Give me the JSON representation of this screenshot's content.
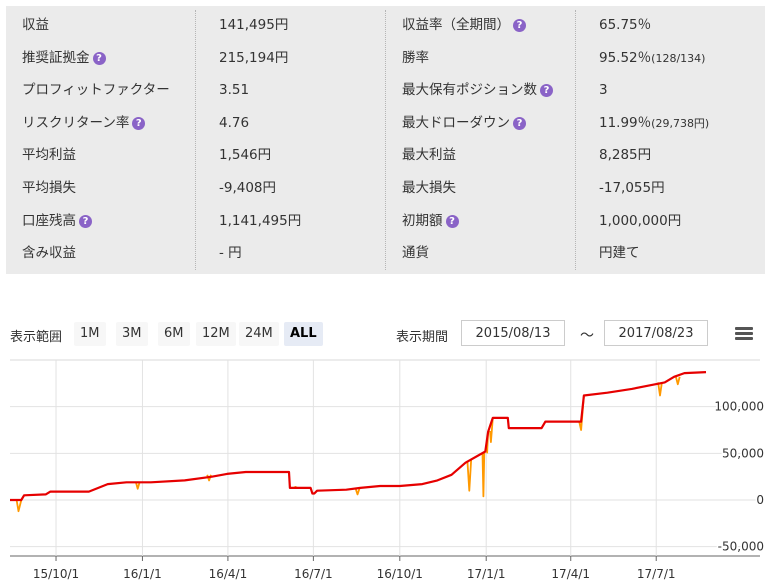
{
  "stats": {
    "rows": [
      {
        "l1": "収益",
        "h1": false,
        "v1": "141,495円",
        "l2": "収益率（全期間）",
        "h2": true,
        "v2": "65.75％",
        "v2sub": ""
      },
      {
        "l1": "推奨証拠金",
        "h1": true,
        "v1": "215,194円",
        "l2": "勝率",
        "h2": false,
        "v2": "95.52％",
        "v2sub": "(128/134)"
      },
      {
        "l1": "プロフィットファクター",
        "h1": false,
        "v1": "3.51",
        "l2": "最大保有ポジション数",
        "h2": true,
        "v2": "3",
        "v2sub": ""
      },
      {
        "l1": "リスクリターン率",
        "h1": true,
        "v1": "4.76",
        "l2": "最大ドローダウン",
        "h2": true,
        "v2": "11.99％",
        "v2sub": "(29,738円)"
      },
      {
        "l1": "平均利益",
        "h1": false,
        "v1": "1,546円",
        "l2": "最大利益",
        "h2": false,
        "v2": "8,285円",
        "v2sub": ""
      },
      {
        "l1": "平均損失",
        "h1": false,
        "v1": "-9,408円",
        "l2": "最大損失",
        "h2": false,
        "v2": "-17,055円",
        "v2sub": ""
      },
      {
        "l1": "口座残高",
        "h1": true,
        "v1": "1,141,495円",
        "l2": "初期額",
        "h2": true,
        "v2": "1,000,000円",
        "v2sub": ""
      },
      {
        "l1": "含み収益",
        "h1": false,
        "v1": "- 円",
        "l2": "通貨",
        "h2": false,
        "v2": "円建て",
        "v2sub": ""
      }
    ],
    "help_glyph": "?"
  },
  "toolbar": {
    "range_label": "表示範囲",
    "range_buttons": [
      "1M",
      "3M",
      "6M",
      "12M",
      "24M",
      "ALL"
    ],
    "active_range": "ALL",
    "period_label": "表示期間",
    "date_from": "2015/08/13",
    "tilde": "～",
    "date_to": "2017/08/23"
  },
  "chart_data": {
    "type": "line",
    "x_tick_labels": [
      "15/10/1",
      "16/1/1",
      "16/4/1",
      "16/7/1",
      "16/10/1",
      "17/1/1",
      "17/4/1",
      "17/7/1"
    ],
    "x_tick_dates": [
      "2015-10-01",
      "2016-01-01",
      "2016-04-01",
      "2016-07-01",
      "2016-10-01",
      "2017-01-01",
      "2017-04-01",
      "2017-07-01"
    ],
    "x_range": [
      "2015-08-13",
      "2017-08-23"
    ],
    "y_ticks": [
      100000,
      50000,
      0,
      -50000
    ],
    "y_tick_labels": [
      "100,000",
      "50,000",
      "0",
      "-50,000"
    ],
    "ylim": [
      -60000,
      150000
    ],
    "grid": true,
    "series": [
      {
        "color": "#e60000",
        "points": [
          [
            "2015-08-13",
            0
          ],
          [
            "2015-08-25",
            0
          ],
          [
            "2015-08-28",
            5000
          ],
          [
            "2015-09-20",
            6000
          ],
          [
            "2015-09-25",
            9000
          ],
          [
            "2015-11-05",
            9000
          ],
          [
            "2015-11-25",
            17000
          ],
          [
            "2015-12-15",
            19000
          ],
          [
            "2016-01-10",
            19000
          ],
          [
            "2016-02-15",
            21000
          ],
          [
            "2016-03-15",
            25000
          ],
          [
            "2016-03-31",
            28000
          ],
          [
            "2016-04-20",
            30000
          ],
          [
            "2016-06-05",
            30000
          ],
          [
            "2016-06-06",
            13000
          ],
          [
            "2016-06-28",
            13000
          ],
          [
            "2016-06-30",
            7000
          ],
          [
            "2016-07-02",
            7000
          ],
          [
            "2016-07-05",
            10000
          ],
          [
            "2016-08-05",
            11000
          ],
          [
            "2016-08-20",
            13000
          ],
          [
            "2016-09-10",
            15000
          ],
          [
            "2016-10-01",
            15000
          ],
          [
            "2016-10-25",
            17000
          ],
          [
            "2016-11-10",
            21000
          ],
          [
            "2016-11-25",
            27000
          ],
          [
            "2016-12-10",
            40000
          ],
          [
            "2016-12-31",
            52000
          ],
          [
            "2017-01-03",
            73000
          ],
          [
            "2017-01-08",
            88000
          ],
          [
            "2017-01-24",
            88000
          ],
          [
            "2017-01-25",
            77000
          ],
          [
            "2017-03-01",
            77000
          ],
          [
            "2017-03-05",
            84000
          ],
          [
            "2017-04-12",
            84000
          ],
          [
            "2017-04-15",
            112000
          ],
          [
            "2017-05-10",
            115000
          ],
          [
            "2017-06-05",
            119000
          ],
          [
            "2017-06-25",
            123000
          ],
          [
            "2017-07-10",
            126000
          ],
          [
            "2017-07-20",
            132000
          ],
          [
            "2017-07-31",
            136000
          ],
          [
            "2017-08-23",
            137000
          ]
        ]
      },
      {
        "color": "#ff9900",
        "points": [
          [
            "2015-08-20",
            0
          ],
          [
            "2015-08-22",
            -12000
          ],
          [
            "2015-08-25",
            0
          ],
          [
            "2015-12-25",
            19000
          ],
          [
            "2015-12-27",
            12000
          ],
          [
            "2015-12-29",
            19000
          ],
          [
            "2016-03-10",
            27000
          ],
          [
            "2016-03-12",
            21000
          ],
          [
            "2016-03-14",
            27000
          ],
          [
            "2016-06-10",
            13000
          ],
          [
            "2016-06-12",
            14000
          ],
          [
            "2016-06-14",
            13000
          ],
          [
            "2016-08-15",
            12000
          ],
          [
            "2016-08-17",
            6000
          ],
          [
            "2016-08-19",
            12000
          ],
          [
            "2016-12-12",
            42000
          ],
          [
            "2016-12-14",
            10000
          ],
          [
            "2016-12-16",
            44000
          ],
          [
            "2016-12-28",
            50000
          ],
          [
            "2016-12-29",
            4000
          ],
          [
            "2016-12-30",
            52000
          ],
          [
            "2017-01-02",
            50000
          ],
          [
            "2017-01-03",
            73000
          ],
          [
            "2017-01-05",
            74000
          ],
          [
            "2017-01-06",
            62000
          ],
          [
            "2017-01-08",
            88000
          ],
          [
            "2017-04-10",
            84000
          ],
          [
            "2017-04-12",
            75000
          ],
          [
            "2017-04-15",
            112000
          ],
          [
            "2017-07-03",
            126000
          ],
          [
            "2017-07-05",
            112000
          ],
          [
            "2017-07-07",
            126000
          ],
          [
            "2017-07-22",
            132000
          ],
          [
            "2017-07-24",
            124000
          ],
          [
            "2017-07-26",
            132000
          ]
        ]
      }
    ]
  }
}
